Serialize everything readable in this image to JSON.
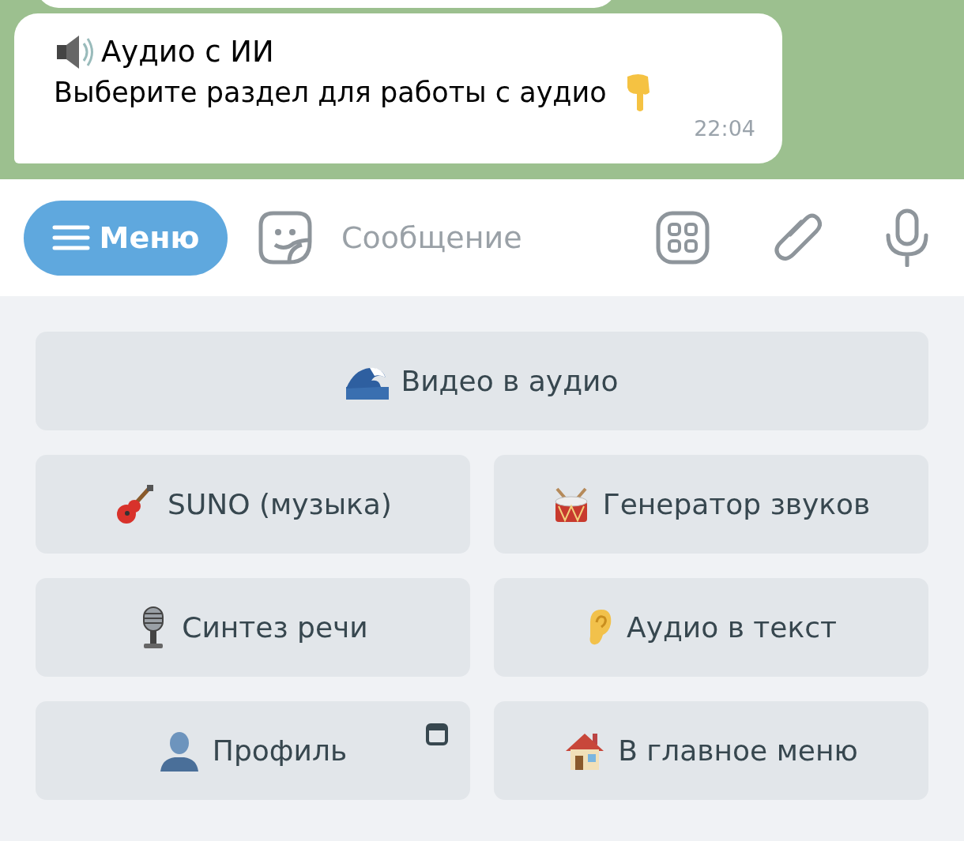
{
  "chat": {
    "message": {
      "title": "Аудио с ИИ",
      "text": "Выберите раздел для работы с аудио",
      "time": "22:04"
    }
  },
  "composer": {
    "menu_button": "Меню",
    "placeholder": "Сообщение"
  },
  "keyboard": {
    "rows": [
      [
        {
          "label": "Видео в аудио",
          "web_app": false
        }
      ],
      [
        {
          "label": "SUNO (музыка)",
          "web_app": false
        },
        {
          "label": "Генератор звуков",
          "web_app": false
        }
      ],
      [
        {
          "label": "Синтез речи",
          "web_app": false
        },
        {
          "label": "Аудио в текст",
          "web_app": false
        }
      ],
      [
        {
          "label": "Профиль",
          "web_app": true
        },
        {
          "label": "В главное меню",
          "web_app": false
        }
      ]
    ]
  }
}
